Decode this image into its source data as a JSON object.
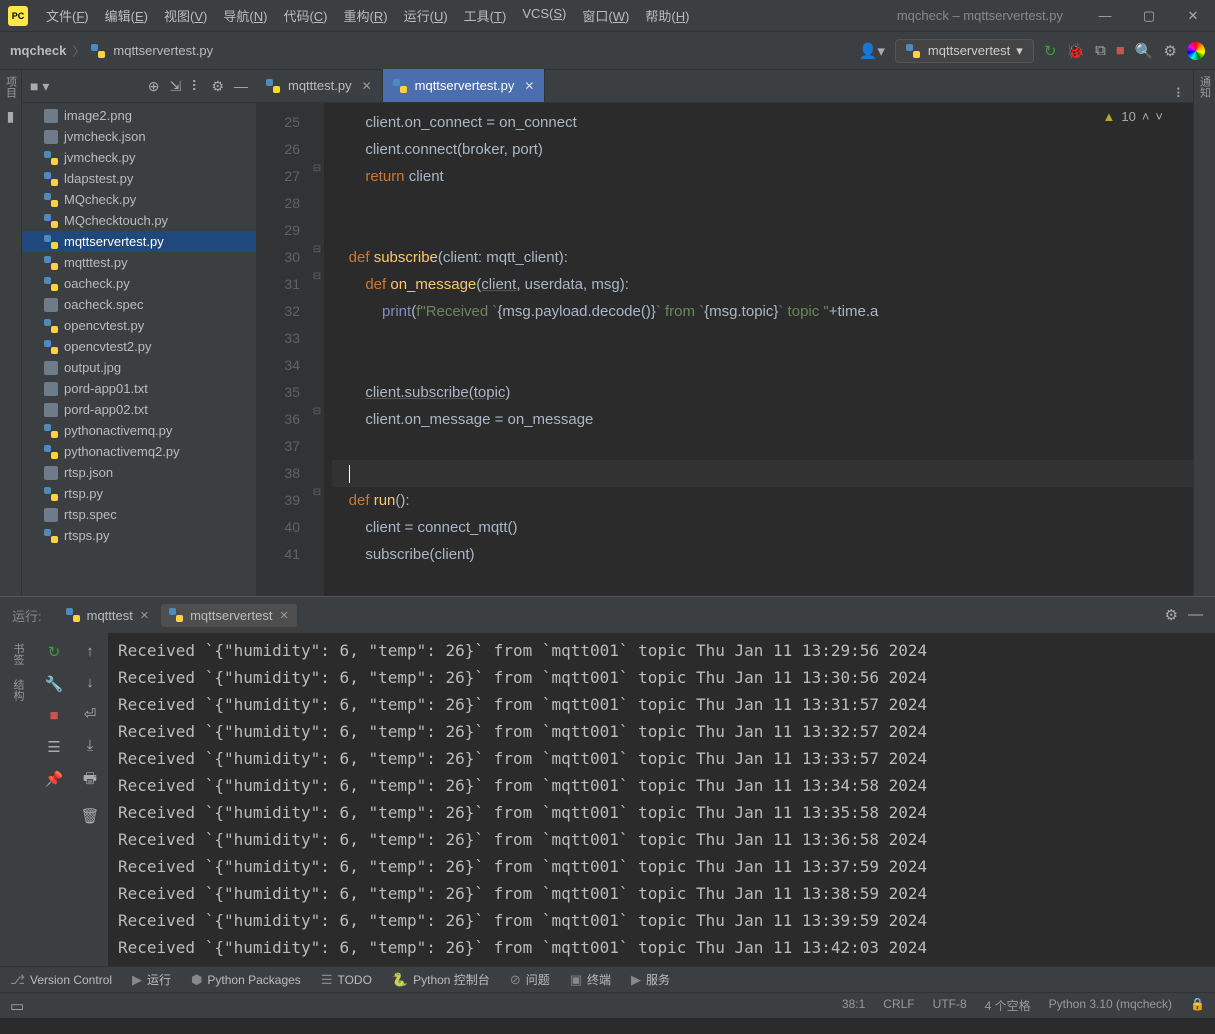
{
  "titlebar": {
    "title": "mqcheck – mqttservertest.py"
  },
  "menu": [
    "文件(F)",
    "编辑(E)",
    "视图(V)",
    "导航(N)",
    "代码(C)",
    "重构(R)",
    "运行(U)",
    "工具(T)",
    "VCS(S)",
    "窗口(W)",
    "帮助(H)"
  ],
  "breadcrumb": {
    "project": "mqcheck",
    "file": "mqttservertest.py"
  },
  "run_config": "mqttservertest",
  "warnings": "10",
  "project_files": [
    {
      "name": "image2.png",
      "type": "generic"
    },
    {
      "name": "jvmcheck.json",
      "type": "generic"
    },
    {
      "name": "jvmcheck.py",
      "type": "py"
    },
    {
      "name": "ldapstest.py",
      "type": "py"
    },
    {
      "name": "MQcheck.py",
      "type": "py"
    },
    {
      "name": "MQchecktouch.py",
      "type": "py"
    },
    {
      "name": "mqttservertest.py",
      "type": "py",
      "selected": true
    },
    {
      "name": "mqtttest.py",
      "type": "py"
    },
    {
      "name": "oacheck.py",
      "type": "py"
    },
    {
      "name": "oacheck.spec",
      "type": "generic"
    },
    {
      "name": "opencvtest.py",
      "type": "py"
    },
    {
      "name": "opencvtest2.py",
      "type": "py"
    },
    {
      "name": "output.jpg",
      "type": "generic"
    },
    {
      "name": "pord-app01.txt",
      "type": "generic"
    },
    {
      "name": "pord-app02.txt",
      "type": "generic"
    },
    {
      "name": "pythonactivemq.py",
      "type": "py"
    },
    {
      "name": "pythonactivemq2.py",
      "type": "py"
    },
    {
      "name": "rtsp.json",
      "type": "generic"
    },
    {
      "name": "rtsp.py",
      "type": "py"
    },
    {
      "name": "rtsp.spec",
      "type": "generic"
    },
    {
      "name": "rtsps.py",
      "type": "py"
    }
  ],
  "editor_tabs": [
    {
      "label": "mqtttest.py",
      "active": false
    },
    {
      "label": "mqttservertest.py",
      "active": true
    }
  ],
  "line_start": 25,
  "line_end": 41,
  "code_lines": [
    {
      "n": 25,
      "html": "        client.on_connect = on_connect"
    },
    {
      "n": 26,
      "html": "        client.connect(broker<span class='op'>,</span> port)"
    },
    {
      "n": 27,
      "html": "        <span class='kw'>return</span> client"
    },
    {
      "n": 28,
      "html": ""
    },
    {
      "n": 29,
      "html": ""
    },
    {
      "n": 30,
      "html": "    <span class='kw'>def</span> <span class='fn'>subscribe</span>(client: mqtt_client):"
    },
    {
      "n": 31,
      "html": "        <span class='kw'>def</span> <span class='fn'>on_message</span>(<span class='under'>client</span><span class='op'>,</span> userdata<span class='op'>,</span> msg):"
    },
    {
      "n": 32,
      "html": "            <span class='builtin'>print</span>(<span class='str'>f\"Received `</span>{msg.payload.decode()}<span class='str'>` from `</span>{msg.topic}<span class='str'>` topic \"</span>+time.a"
    },
    {
      "n": 33,
      "html": ""
    },
    {
      "n": 34,
      "html": ""
    },
    {
      "n": 35,
      "html": "        <span class='under'>client.subscribe(topic)</span>"
    },
    {
      "n": 36,
      "html": "        client.on_message = on_message"
    },
    {
      "n": 37,
      "html": ""
    },
    {
      "n": 38,
      "html": "    <span class='caret'></span>",
      "current": true
    },
    {
      "n": 39,
      "html": "    <span class='kw'>def</span> <span class='fn'>run</span>():"
    },
    {
      "n": 40,
      "html": "        client = connect_mqtt()"
    },
    {
      "n": 41,
      "html": "        subscribe(client)"
    }
  ],
  "run_tabs": [
    {
      "label": "mqtttest",
      "active": false
    },
    {
      "label": "mqttservertest",
      "active": true
    }
  ],
  "run_label": "运行:",
  "console_lines": [
    "Received `{\"humidity\": 6, \"temp\": 26}` from `mqtt001` topic Thu Jan 11 13:29:56 2024",
    "Received `{\"humidity\": 6, \"temp\": 26}` from `mqtt001` topic Thu Jan 11 13:30:56 2024",
    "Received `{\"humidity\": 6, \"temp\": 26}` from `mqtt001` topic Thu Jan 11 13:31:57 2024",
    "Received `{\"humidity\": 6, \"temp\": 26}` from `mqtt001` topic Thu Jan 11 13:32:57 2024",
    "Received `{\"humidity\": 6, \"temp\": 26}` from `mqtt001` topic Thu Jan 11 13:33:57 2024",
    "Received `{\"humidity\": 6, \"temp\": 26}` from `mqtt001` topic Thu Jan 11 13:34:58 2024",
    "Received `{\"humidity\": 6, \"temp\": 26}` from `mqtt001` topic Thu Jan 11 13:35:58 2024",
    "Received `{\"humidity\": 6, \"temp\": 26}` from `mqtt001` topic Thu Jan 11 13:36:58 2024",
    "Received `{\"humidity\": 6, \"temp\": 26}` from `mqtt001` topic Thu Jan 11 13:37:59 2024",
    "Received `{\"humidity\": 6, \"temp\": 26}` from `mqtt001` topic Thu Jan 11 13:38:59 2024",
    "Received `{\"humidity\": 6, \"temp\": 26}` from `mqtt001` topic Thu Jan 11 13:39:59 2024",
    "Received `{\"humidity\": 6, \"temp\": 26}` from `mqtt001` topic Thu Jan 11 13:42:03 2024"
  ],
  "bottom_tabs": [
    {
      "ico": "⎇",
      "label": "Version Control"
    },
    {
      "ico": "▶",
      "label": "运行"
    },
    {
      "ico": "⬢",
      "label": "Python Packages"
    },
    {
      "ico": "☰",
      "label": "TODO"
    },
    {
      "ico": "🐍",
      "label": "Python 控制台"
    },
    {
      "ico": "⊘",
      "label": "问题"
    },
    {
      "ico": "▣",
      "label": "终端"
    },
    {
      "ico": "▶",
      "label": "服务"
    }
  ],
  "statusbar": {
    "pos": "38:1",
    "crlf": "CRLF",
    "enc": "UTF-8",
    "indent": "4 个空格",
    "interp": "Python 3.10 (mqcheck)"
  },
  "left_side": {
    "project": "项目"
  },
  "right_side": {
    "notifications": "通知"
  },
  "left_bottom": [
    "书签",
    "结构"
  ]
}
